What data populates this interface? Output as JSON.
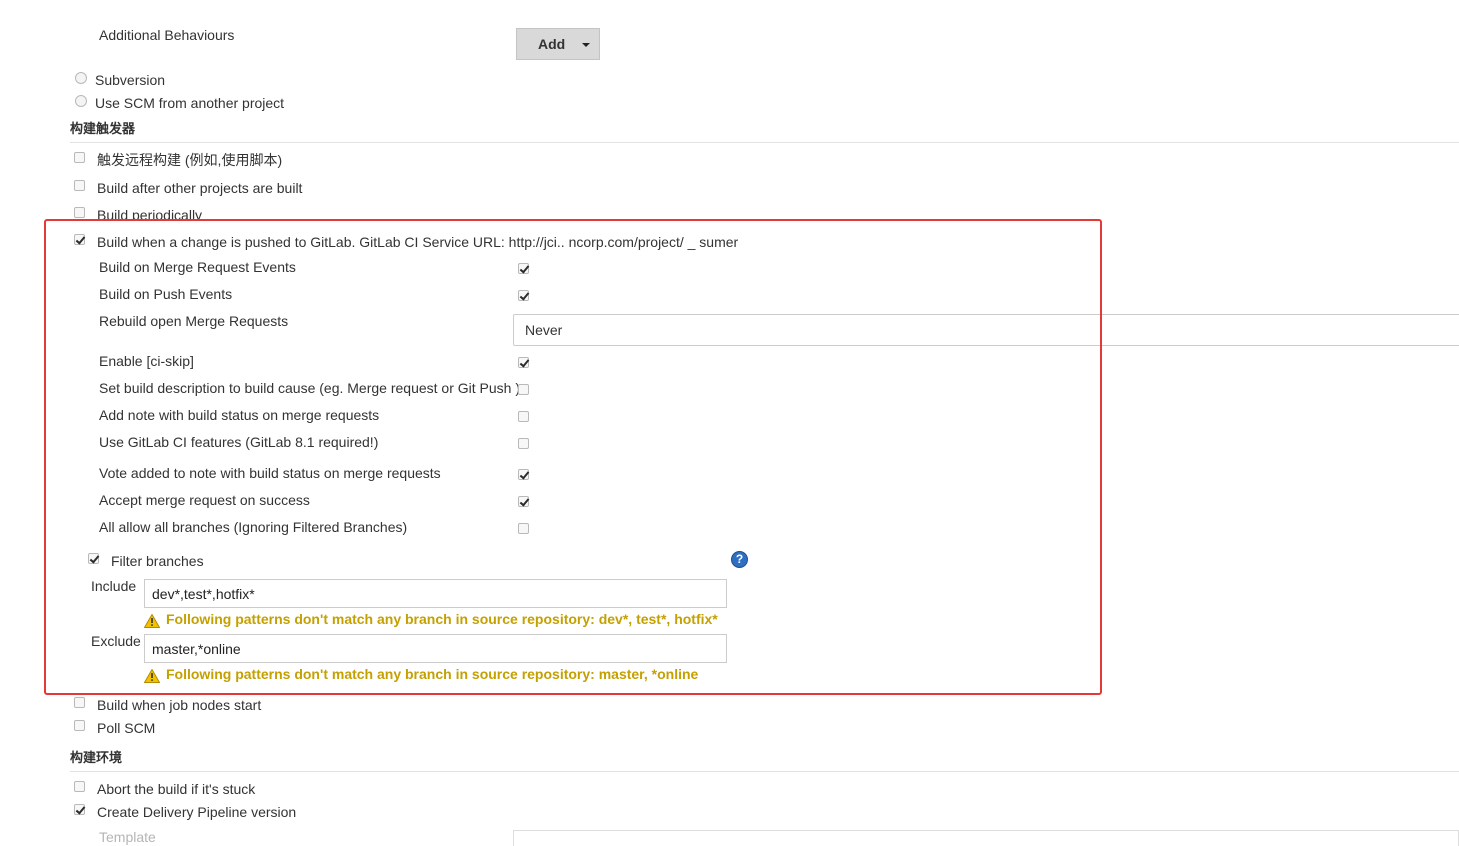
{
  "scm": {
    "additional_behaviours_label": "Additional Behaviours",
    "add_button_label": "Add",
    "options": [
      {
        "label": "Subversion"
      },
      {
        "label": "Use SCM from another project"
      }
    ]
  },
  "build_triggers": {
    "section_title": "构建触发器",
    "items": [
      {
        "label": "触发远程构建 (例如,使用脚本)",
        "checked": false
      },
      {
        "label": "Build after other projects are built",
        "checked": false
      },
      {
        "label": "Build periodically",
        "checked": false
      },
      {
        "label": "Build when a change is pushed to GitLab. GitLab CI Service URL: http://jci..     ncorp.com/project/ _                                        sumer",
        "checked": true
      }
    ],
    "gitlab": {
      "settings": [
        {
          "label": "Build on Merge Request Events",
          "checked": true
        },
        {
          "label": "Build on Push Events",
          "checked": true
        },
        {
          "label": "Rebuild open Merge Requests",
          "value": "Never"
        },
        {
          "label": "Enable [ci-skip]",
          "checked": true
        },
        {
          "label": "Set build description to build cause (eg. Merge request or Git Push )",
          "checked": false
        },
        {
          "label": "Add note with build status on merge requests",
          "checked": false
        },
        {
          "label": "Use GitLab CI features (GitLab 8.1 required!)",
          "checked": false
        },
        {
          "label": "Vote added to note with build status on merge requests",
          "checked": true
        },
        {
          "label": "Accept merge request on success",
          "checked": true
        },
        {
          "label": "All allow all branches (Ignoring Filtered Branches)",
          "checked": false
        }
      ],
      "filter_branches": {
        "label": "Filter branches",
        "checked": true,
        "help_icon": "question-mark-icon",
        "include_label": "Include",
        "include_value": "dev*,test*,hotfix*",
        "include_warning": "Following patterns don't match any branch in source repository: dev*, test*, hotfix*",
        "exclude_label": "Exclude",
        "exclude_value": "master,*online",
        "exclude_warning": "Following patterns don't match any branch in source repository: master, *online"
      }
    },
    "after_items": [
      {
        "label": "Build when job nodes start",
        "checked": false
      },
      {
        "label": "Poll SCM",
        "checked": false
      }
    ]
  },
  "build_env": {
    "section_title": "构建环境",
    "items": [
      {
        "label": "Abort the build if it's stuck",
        "checked": false
      },
      {
        "label": "Create Delivery Pipeline version",
        "checked": true
      }
    ],
    "template_label": "Template"
  },
  "colors": {
    "warning": "#c4a000",
    "highlight_border": "#e53935",
    "help_icon": "#2f6fc1"
  }
}
